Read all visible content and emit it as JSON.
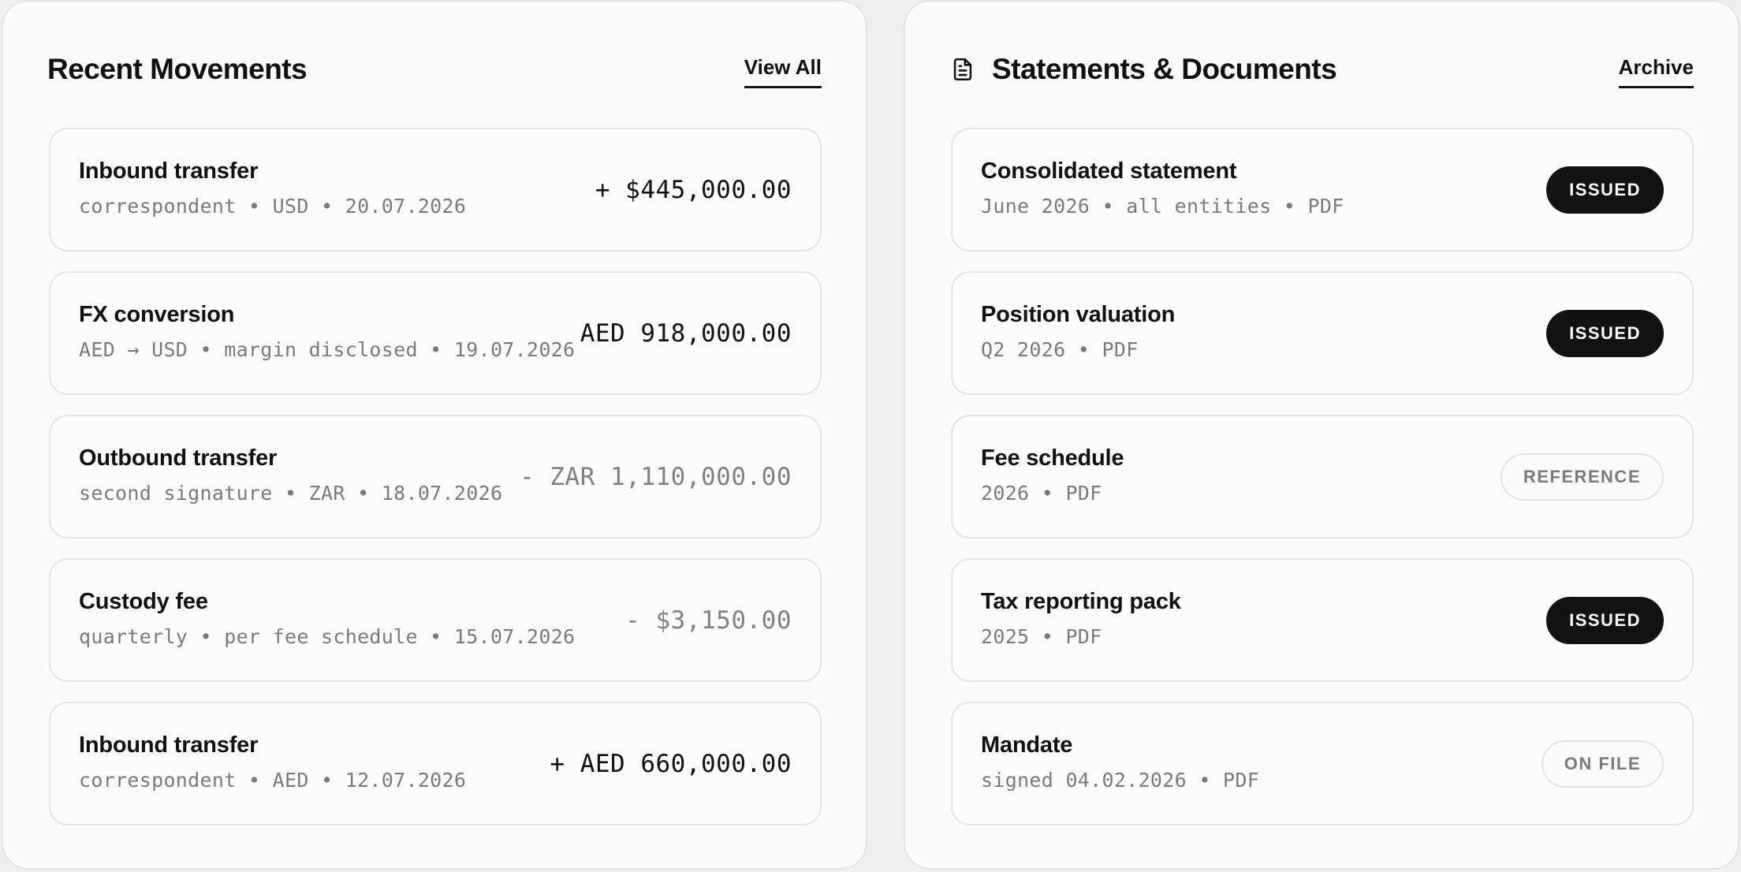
{
  "movements": {
    "title": "Recent Movements",
    "link_label": "View All",
    "items": [
      {
        "title": "Inbound transfer",
        "meta": "correspondent • USD • 20.07.2026",
        "amount": "+ $445,000.00",
        "direction": "in"
      },
      {
        "title": "FX conversion",
        "meta": "AED → USD • margin disclosed • 19.07.2026",
        "amount": "AED 918,000.00",
        "direction": "neutral"
      },
      {
        "title": "Outbound transfer",
        "meta": "second signature • ZAR • 18.07.2026",
        "amount": "- ZAR 1,110,000.00",
        "direction": "out"
      },
      {
        "title": "Custody fee",
        "meta": "quarterly • per fee schedule • 15.07.2026",
        "amount": "- $3,150.00",
        "direction": "out"
      },
      {
        "title": "Inbound transfer",
        "meta": "correspondent • AED • 12.07.2026",
        "amount": "+ AED 660,000.00",
        "direction": "in"
      }
    ]
  },
  "documents": {
    "title": "Statements & Documents",
    "title_icon": "document-icon",
    "link_label": "Archive",
    "items": [
      {
        "title": "Consolidated statement",
        "meta": "June 2026 • all entities • PDF",
        "status": "ISSUED",
        "style": "solid"
      },
      {
        "title": "Position valuation",
        "meta": "Q2 2026 • PDF",
        "status": "ISSUED",
        "style": "solid"
      },
      {
        "title": "Fee schedule",
        "meta": "2026 • PDF",
        "status": "REFERENCE",
        "style": "outline"
      },
      {
        "title": "Tax reporting pack",
        "meta": "2025 • PDF",
        "status": "ISSUED",
        "style": "solid"
      },
      {
        "title": "Mandate",
        "meta": "signed 04.02.2026 • PDF",
        "status": "ON FILE",
        "style": "outline"
      }
    ]
  },
  "colors": {
    "background": "#efefef",
    "panel": "#fbfbfb",
    "text_primary": "#111111",
    "text_muted": "#7a7a7a",
    "badge_solid": "#121212"
  }
}
